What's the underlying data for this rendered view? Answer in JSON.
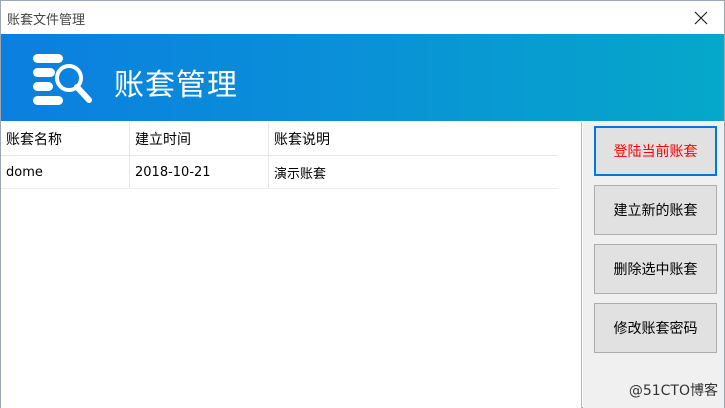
{
  "window": {
    "title": "账套文件管理",
    "close_icon": "close-icon"
  },
  "banner": {
    "title": "账套管理",
    "icon": "database-search-icon"
  },
  "table": {
    "columns": [
      "账套名称",
      "建立时间",
      "账套说明"
    ],
    "rows": [
      [
        "dome",
        "2018-10-21",
        "演示账套"
      ]
    ]
  },
  "actions": {
    "login": "登陆当前账套",
    "create": "建立新的账套",
    "delete": "删除选中账套",
    "change_password": "修改账套密码"
  },
  "watermark": "@51CTO博客",
  "colors": {
    "banner_start": "#0b7fe0",
    "banner_end": "#05a8c9",
    "primary_text": "#ff0000",
    "focus_border": "#0078d7"
  }
}
